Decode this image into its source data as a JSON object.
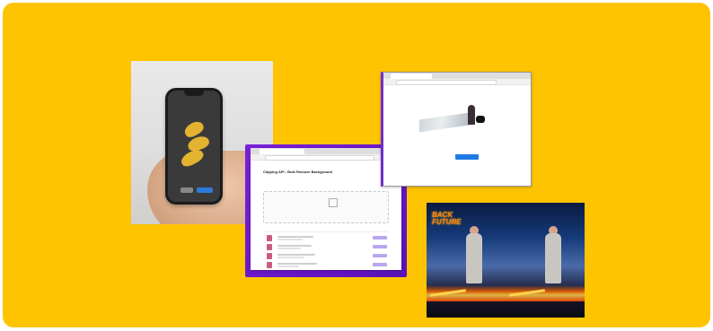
{
  "colors": {
    "banner": "#FEC401",
    "clipping_frame": "#6A18C8",
    "cta": "#2179E6"
  },
  "clipping_window": {
    "title": "Clipping API - Bulk Remove Background",
    "subtitle": "",
    "dropzone_text": "",
    "rows": 4
  },
  "bg_window": {
    "brand": "",
    "cta_label": "",
    "under_link": ""
  },
  "poster": {
    "title_line1": "BACK",
    "title_line2": "FUTURE",
    "subtitle": "",
    "credits": ""
  },
  "icons": {
    "phone": "phone-icon",
    "dropzone": "upload-icon"
  }
}
